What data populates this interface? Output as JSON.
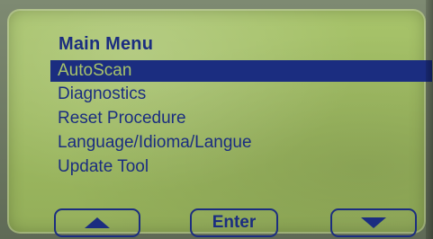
{
  "screen": {
    "title": "Main Menu",
    "menu_items": [
      {
        "label": "AutoScan",
        "selected": true
      },
      {
        "label": "Diagnostics",
        "selected": false
      },
      {
        "label": "Reset Procedure",
        "selected": false
      },
      {
        "label": "Language/Idioma/Langue",
        "selected": false
      },
      {
        "label": "Update Tool",
        "selected": false
      }
    ]
  },
  "buttons": {
    "up": {
      "icon": "arrow-up-icon"
    },
    "enter": {
      "label": "Enter"
    },
    "down": {
      "icon": "arrow-down-icon"
    }
  },
  "colors": {
    "lcd_background": "#a7c36a",
    "text": "#1b2d80",
    "selection_background": "#1b2d80"
  }
}
